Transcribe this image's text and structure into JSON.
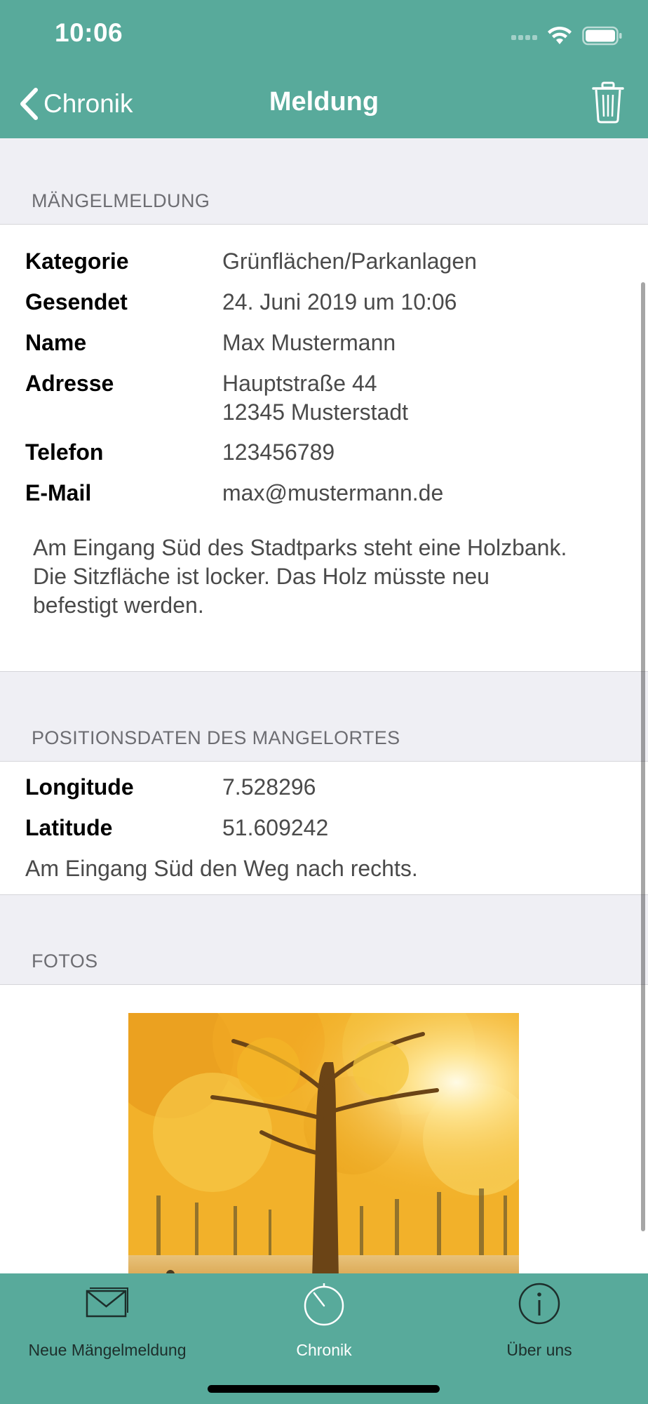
{
  "status_bar": {
    "time": "10:06"
  },
  "nav": {
    "back_label": "Chronik",
    "title": "Meldung",
    "accent_color": "#58aa9b"
  },
  "report": {
    "section_title": "MÄNGELMELDUNG",
    "fields": [
      {
        "label": "Kategorie",
        "value": "Grünflächen/Parkanlagen"
      },
      {
        "label": "Gesendet",
        "value": "24. Juni 2019 um 10:06"
      },
      {
        "label": "Name",
        "value": "Max Mustermann"
      },
      {
        "label": "Adresse",
        "value_line1": "Hauptstraße 44",
        "value_line2": "12345 Musterstadt"
      },
      {
        "label": "Telefon",
        "value": "123456789"
      },
      {
        "label": "E-Mail",
        "value": "max@mustermann.de"
      }
    ],
    "description_lines": [
      "Am Eingang Süd des Stadtparks steht eine Holzbank.",
      "Die Sitzfläche ist locker. Das Holz müsste neu",
      "befestigt werden."
    ]
  },
  "position": {
    "section_title": "POSITIONSDATEN DES MANGELORTES",
    "fields": [
      {
        "label": "Longitude",
        "value": "7.528296"
      },
      {
        "label": "Latitude",
        "value": "51.609242"
      }
    ],
    "note": "Am Eingang Süd den Weg nach rechts."
  },
  "photos": {
    "section_title": "FOTOS",
    "items": [
      {
        "subject": "autumn tree in park"
      }
    ]
  },
  "tabbar": {
    "tabs": [
      {
        "label": "Neue Mängelmeldung",
        "icon": "envelope-icon",
        "active": false
      },
      {
        "label": "Chronik",
        "icon": "timer-icon",
        "active": true
      },
      {
        "label": "Über uns",
        "icon": "info-icon",
        "active": false
      }
    ]
  }
}
